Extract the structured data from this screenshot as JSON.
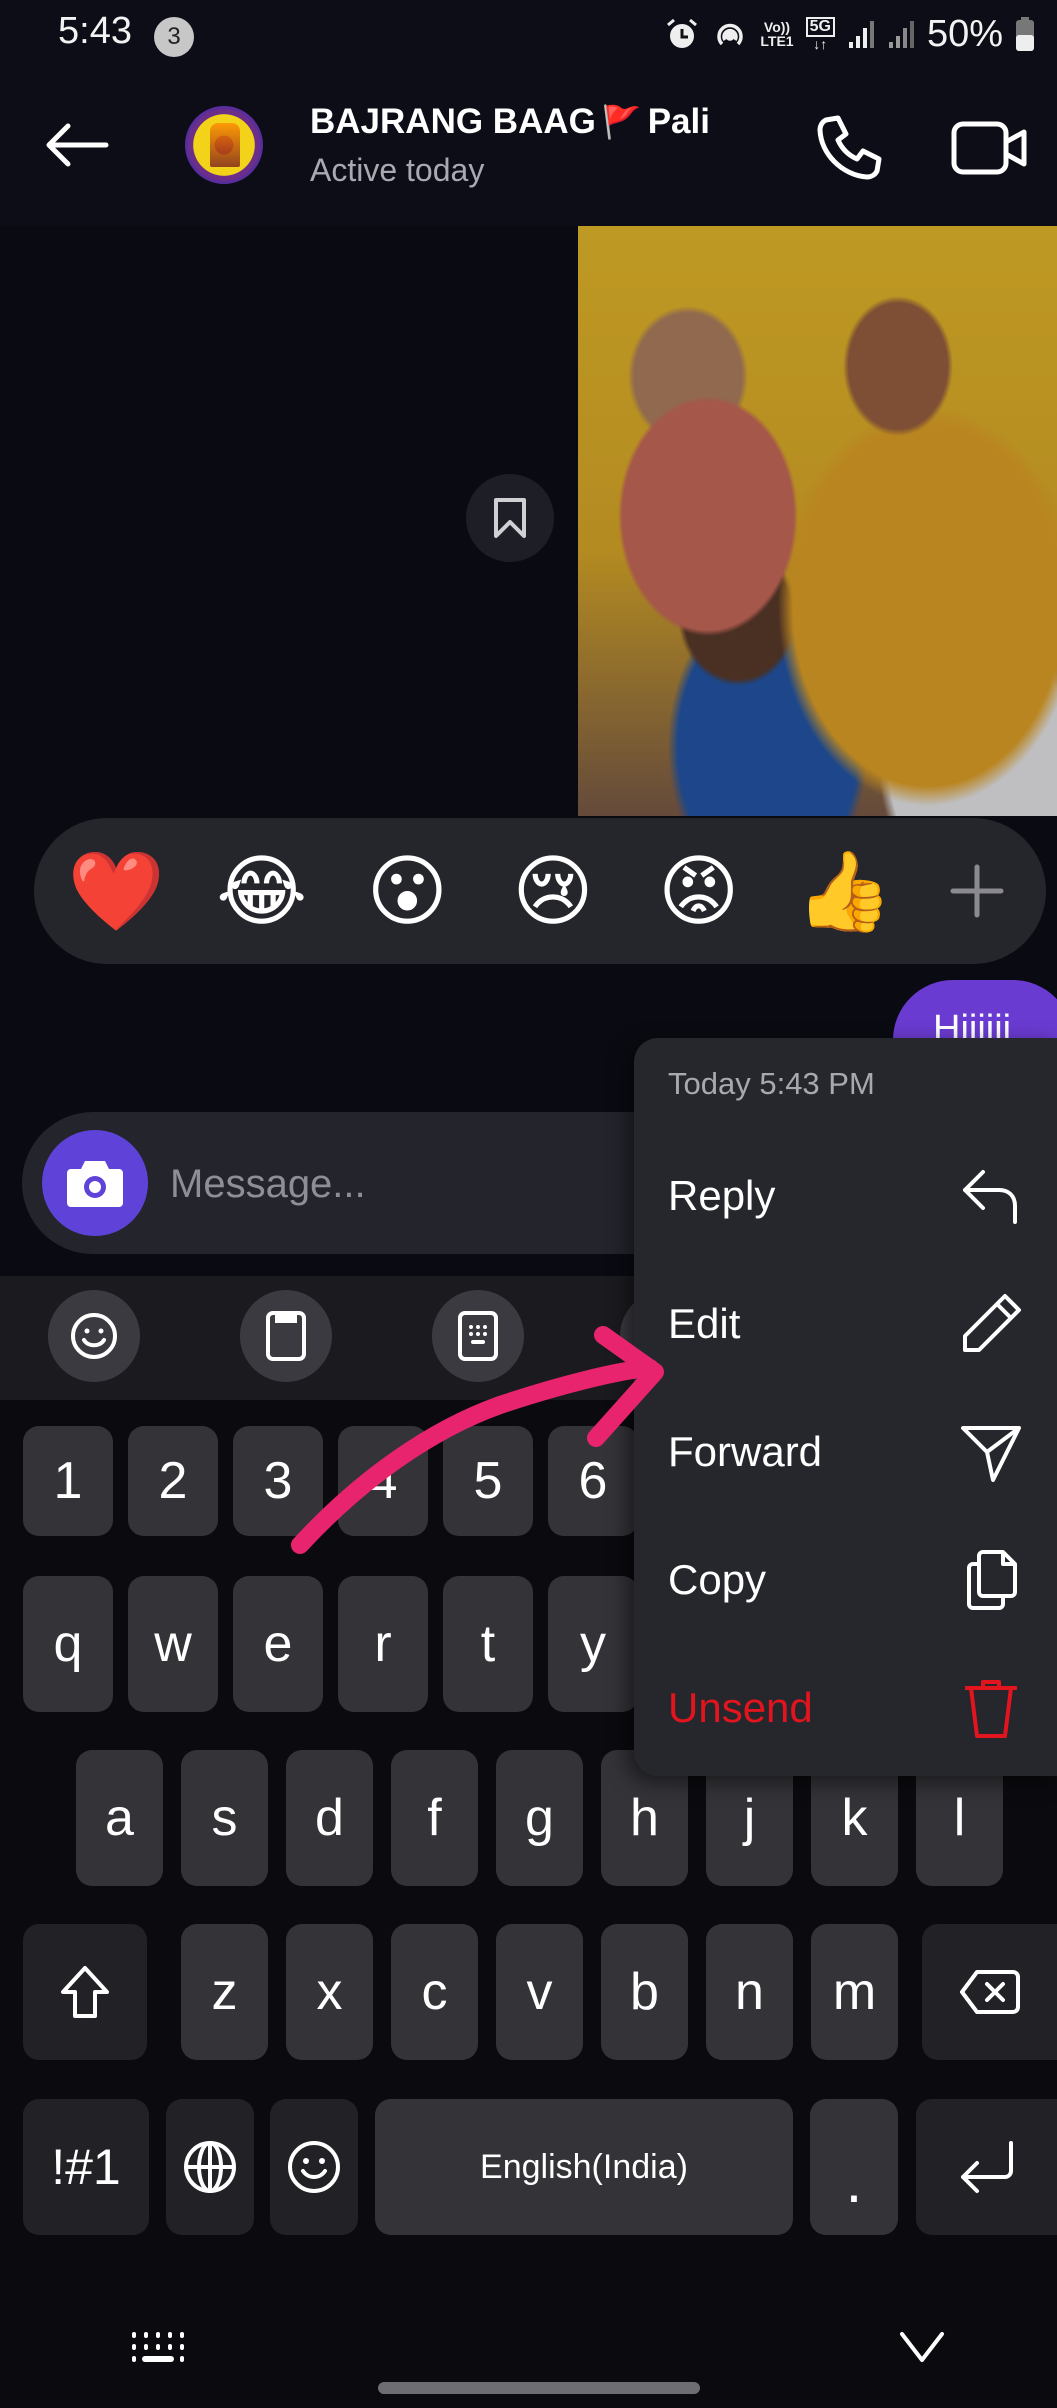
{
  "status_bar": {
    "time": "5:43",
    "notification_count": "3",
    "icons": [
      "alarm-icon",
      "hotspot-icon",
      "volte-icon",
      "5g-icon",
      "signal-icon",
      "signal-icon"
    ],
    "volte_label_top": "Vo))",
    "volte_label_bottom": "LTE1",
    "network_label": "5G",
    "battery_text": "50%",
    "battery_level": 0.5
  },
  "header": {
    "back_icon": "arrow-left-icon",
    "chat_name": "BAJRANG BAAG",
    "chat_name_flag": "🚩",
    "chat_name_suffix": "Pali",
    "status": "Active today",
    "call_icon": "phone-icon",
    "video_icon": "video-camera-icon"
  },
  "chat": {
    "bookmark_icon": "bookmark-icon",
    "reactions": [
      {
        "emoji": "❤️",
        "name": "heart"
      },
      {
        "emoji": "😂",
        "name": "laughing"
      },
      {
        "emoji": "😮",
        "name": "surprised"
      },
      {
        "emoji": "😢",
        "name": "crying"
      },
      {
        "emoji": "😡",
        "name": "angry"
      },
      {
        "emoji": "👍",
        "name": "thumbs-up"
      }
    ],
    "reaction_more_icon": "plus-icon",
    "selected_message": "Hiiiiii"
  },
  "context_menu": {
    "timestamp": "Today 5:43 PM",
    "items": [
      {
        "label": "Reply",
        "icon": "reply-icon"
      },
      {
        "label": "Edit",
        "icon": "pencil-icon"
      },
      {
        "label": "Forward",
        "icon": "send-icon"
      },
      {
        "label": "Copy",
        "icon": "copy-icon"
      },
      {
        "label": "Unsend",
        "icon": "trash-icon",
        "danger": true
      }
    ],
    "danger_color": "#e2141d"
  },
  "composer": {
    "camera_icon": "camera-icon",
    "placeholder": "Message...",
    "value": "",
    "accent_color": "#5f43d9"
  },
  "keyboard_toolbar": {
    "buttons": [
      "emoji-icon",
      "clipboard-icon",
      "keypad-icon"
    ]
  },
  "keyboard": {
    "number_row": [
      "1",
      "2",
      "3",
      "4",
      "5",
      "6"
    ],
    "row1": [
      "q",
      "w",
      "e",
      "r",
      "t",
      "y"
    ],
    "row2": [
      "a",
      "s",
      "d",
      "f",
      "g",
      "h",
      "j",
      "k",
      "l"
    ],
    "row3": [
      "z",
      "x",
      "c",
      "v",
      "b",
      "n",
      "m"
    ],
    "symbols_label": "!#1",
    "space_label": "English(India)",
    "period_label": ".",
    "shift_icon": "shift-icon",
    "backspace_icon": "backspace-icon",
    "globe_icon": "globe-icon",
    "emoji_icon": "emoji-icon",
    "enter_icon": "enter-icon"
  },
  "nav_bar": {
    "keyboard_switch_icon": "keyboard-icon",
    "hide_keyboard_icon": "chevron-down-icon"
  },
  "annotation": {
    "arrow_color": "#e8246e",
    "points_to": "Edit"
  },
  "bubble_color": "#6a3bd1"
}
